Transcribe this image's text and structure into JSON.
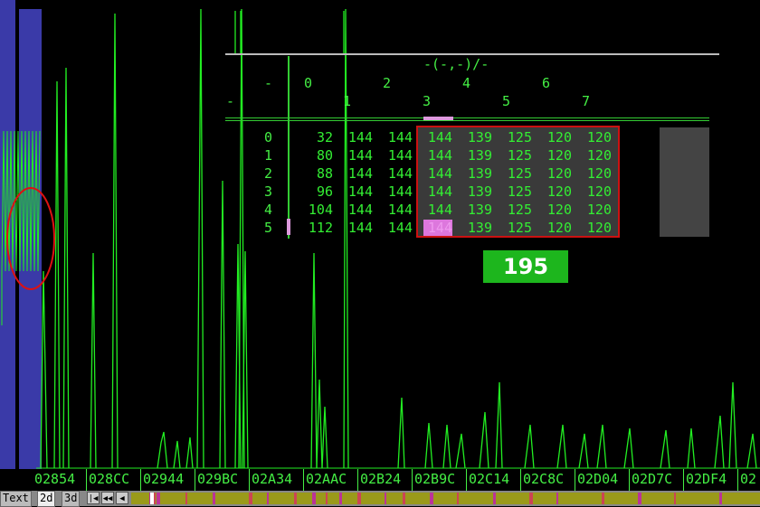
{
  "table": {
    "title": "-(-,-)/-",
    "corner_dash_top": "-",
    "corner_dash_left": "-",
    "col_headers_even": [
      "0",
      "2",
      "4",
      "6"
    ],
    "col_headers_odd": [
      "1",
      "3",
      "5",
      "7"
    ],
    "row_labels": [
      "0",
      "1",
      "2",
      "3",
      "4",
      "5"
    ],
    "rows": [
      [
        "32",
        "144",
        "144",
        "144",
        "139",
        "125",
        "120",
        "120"
      ],
      [
        "80",
        "144",
        "144",
        "144",
        "139",
        "125",
        "120",
        "120"
      ],
      [
        "88",
        "144",
        "144",
        "144",
        "139",
        "125",
        "120",
        "120"
      ],
      [
        "96",
        "144",
        "144",
        "144",
        "139",
        "125",
        "120",
        "120"
      ],
      [
        "104",
        "144",
        "144",
        "144",
        "139",
        "125",
        "120",
        "120"
      ],
      [
        "112",
        "144",
        "144",
        "144",
        "139",
        "125",
        "120",
        "120"
      ]
    ],
    "selected_cell": {
      "row": 5,
      "col": 3
    }
  },
  "value_badge": "195",
  "address_labels": [
    "02854",
    "028CC",
    "02944",
    "029BC",
    "02A34",
    "02AAC",
    "02B24",
    "02B9C",
    "02C14",
    "02C8C",
    "02D04",
    "02D7C",
    "02DF4",
    "02"
  ],
  "tabs": {
    "text": "Text",
    "two_d": "2d",
    "three_d": "3d"
  },
  "nav_buttons": {
    "first": "|◀",
    "prev_fast": "◀◀",
    "prev": "◀"
  },
  "colors": {
    "waveform": "#22ee22",
    "highlight_band": "#3a3aa8",
    "selection_border": "#cc1111",
    "badge": "#1db61d",
    "marker": "#dd77dd"
  }
}
